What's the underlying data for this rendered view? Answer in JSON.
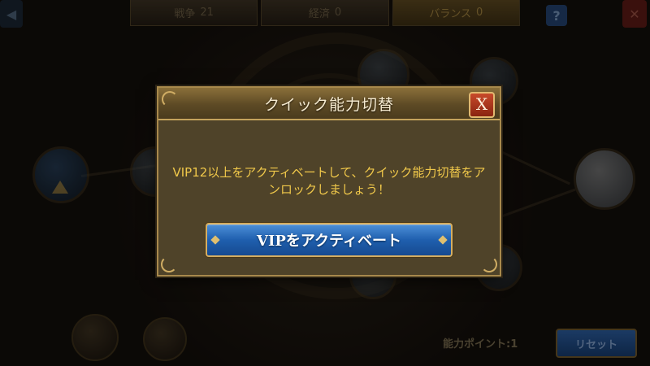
{
  "background": {
    "tabs": [
      {
        "label": "戦争",
        "value": "21",
        "active": false
      },
      {
        "label": "経済",
        "value": "0",
        "active": false
      },
      {
        "label": "バランス",
        "value": "0",
        "active": true
      }
    ],
    "help_label": "?",
    "points_label": "能力ポイント:1",
    "reset_label": "リセット"
  },
  "dialog": {
    "title": "クイック能力切替",
    "close_label": "X",
    "message": "VIP12以上をアクティベートして、クイック能力切替をアンロックしましょう！",
    "activate_button_label": "VIPをアクティベート"
  },
  "colors": {
    "dialog_bg": "#4f4329",
    "dialog_border": "#a8894c",
    "message_text": "#f0c84a",
    "button_blue": "#1f5fae",
    "close_red": "#c84a2a"
  }
}
